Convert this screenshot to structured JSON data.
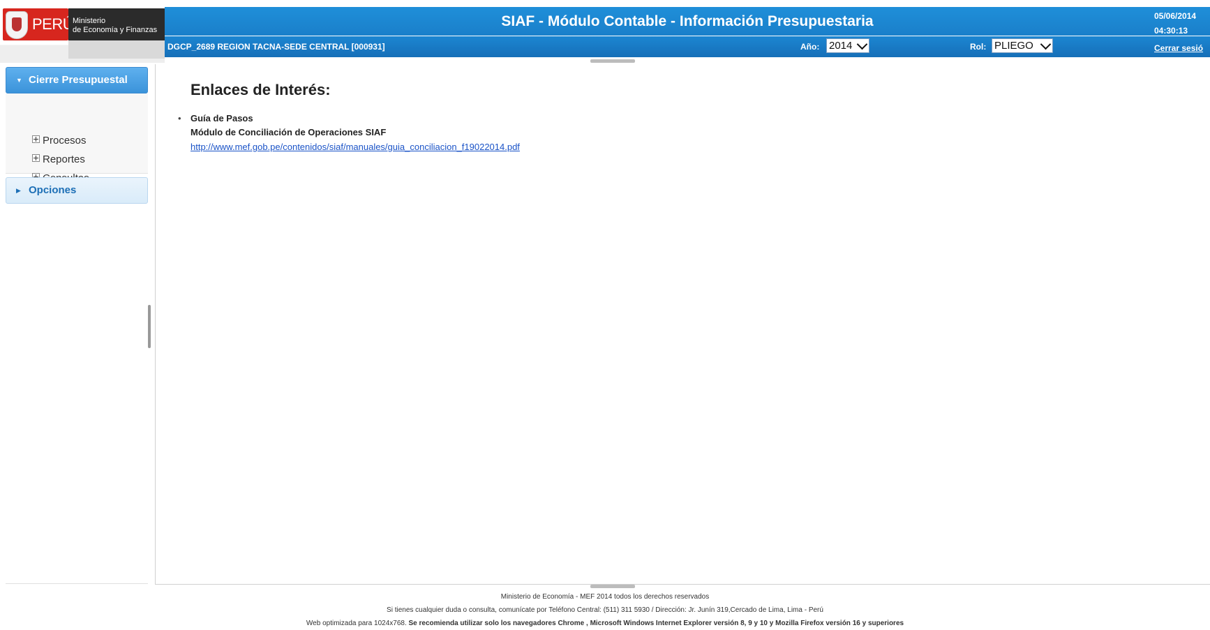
{
  "header": {
    "logo": {
      "country": "PERÚ",
      "ministry_line1": "Ministerio",
      "ministry_line2": "de Economía y Finanzas"
    },
    "title": "SIAF - Módulo Contable - Información Presupuestaria",
    "entity": "DGCP_2689  REGION TACNA-SEDE CENTRAL  [000931]",
    "year_label": "Año:",
    "year_value": "2014",
    "role_label": "Rol:",
    "role_value": "PLIEGO",
    "date": "05/06/2014",
    "time": "04:30:13",
    "logout": "Cerrar sesió"
  },
  "sidebar": {
    "panels": [
      {
        "label": "Cierre Presupuestal",
        "expanded": true,
        "items": [
          {
            "label": "Procesos"
          },
          {
            "label": "Reportes"
          },
          {
            "label": "Consultas"
          }
        ]
      },
      {
        "label": "Opciones",
        "expanded": false
      }
    ]
  },
  "main": {
    "title": "Enlaces de Interés:",
    "links": [
      {
        "title": "Guía de Pasos",
        "subtitle": "Módulo de Conciliación de Operaciones SIAF",
        "url": "http://www.mef.gob.pe/contenidos/siaf/manuales/guia_conciliacion_f19022014.pdf"
      }
    ]
  },
  "footer": {
    "line1": "Ministerio de Economía - MEF 2014 todos los derechos reservados",
    "line2": "Si tienes cualquier duda o consulta, comunícate por Teléfono Central: (511) 311 5930 / Dirección: Jr. Junín 319,Cercado de Lima, Lima - Perú",
    "line3_prefix": "Web optimizada para 1024x768. ",
    "line3_bold": "Se recomienda utilizar solo los navegadores Chrome , Microsoft Windows Internet Explorer versión 8, 9 y 10 y Mozilla Firefox versión 16 y superiores"
  },
  "colors": {
    "header_blue": "#1a7fca",
    "accordion_active": "#3b93da",
    "link_blue": "#1a53c7",
    "logo_red": "#d7261e"
  },
  "icons": {
    "expand": "plus-square-icon",
    "collapse": "triangle-down-icon",
    "collapsed": "triangle-right-icon",
    "dropdown": "chevron-down-icon"
  }
}
